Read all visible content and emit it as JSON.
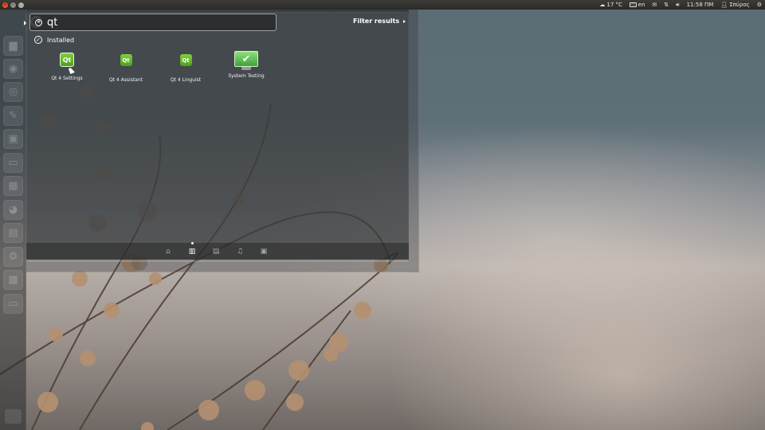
{
  "top_panel": {
    "window_buttons": [
      "close",
      "minimize",
      "maximize"
    ],
    "weather": "17 °C",
    "keyboard_layout": "en",
    "time": "11:58 ΠΜ",
    "user": "Σπύρος",
    "icons": [
      "weather-icon",
      "keyboard-icon",
      "mail-icon",
      "network-icon",
      "volume-icon",
      "user-icon",
      "gear-icon"
    ]
  },
  "dash": {
    "search": {
      "value": "qt",
      "placeholder": ""
    },
    "filter_label": "Filter results",
    "category": "Installed",
    "results": [
      {
        "label": "Qt 4 Settings",
        "icon": "qt-settings-icon",
        "glyph": "Qt"
      },
      {
        "label": "Qt 4 Assistant",
        "icon": "qt-assistant-icon",
        "glyph": "Qt"
      },
      {
        "label": "Qt 4 Linguist",
        "icon": "qt-linguist-icon",
        "glyph": "Qt"
      },
      {
        "label": "System Testing",
        "icon": "system-testing-icon",
        "glyph": "✔"
      }
    ],
    "lenses": [
      {
        "name": "home",
        "glyph": "⌂",
        "active": false
      },
      {
        "name": "applications",
        "glyph": "▥",
        "active": true
      },
      {
        "name": "files",
        "glyph": "▤",
        "active": false
      },
      {
        "name": "music",
        "glyph": "♫",
        "active": false
      },
      {
        "name": "video",
        "glyph": "▣",
        "active": false
      }
    ]
  },
  "launcher": {
    "items": [
      "dash-home",
      "files",
      "firefox",
      "chromium",
      "libreoffice-writer",
      "software-center",
      "terminal",
      "calculator",
      "gimp",
      "spreadsheet",
      "settings",
      "workspace-switcher",
      "workspace"
    ]
  },
  "colors": {
    "accent": "#e95420",
    "qt_green": "#5fb82a",
    "panel": "#3c3b37"
  }
}
